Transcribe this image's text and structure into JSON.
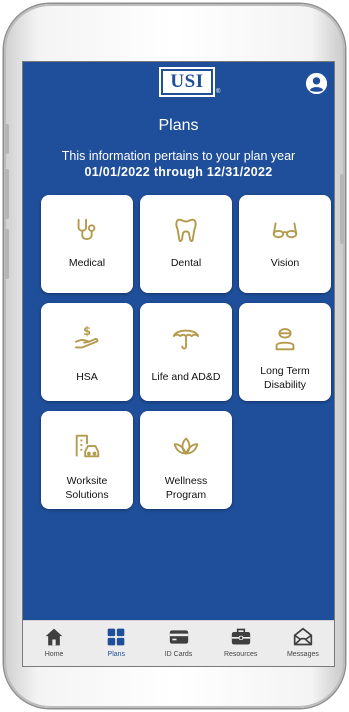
{
  "colors": {
    "primary_blue": "#1f4f9b",
    "icon_gold": "#b39a4c",
    "tab_gray": "#3f3f3f",
    "tab_active": "#1f4f9b"
  },
  "header": {
    "logo_text": "USI",
    "logo_mark": "®",
    "profile_icon": "person-circle-icon"
  },
  "page": {
    "title": "Plans",
    "info": "This information pertains to your plan year",
    "dates": "01/01/2022 through 12/31/2022"
  },
  "plans": [
    {
      "label": "Medical",
      "icon": "stethoscope-icon"
    },
    {
      "label": "Dental",
      "icon": "tooth-icon"
    },
    {
      "label": "Vision",
      "icon": "glasses-icon"
    },
    {
      "label": "HSA",
      "icon": "hand-dollar-icon"
    },
    {
      "label": "Life and AD&D",
      "icon": "umbrella-icon"
    },
    {
      "label": "Long Term Disability",
      "icon": "person-helmet-icon"
    },
    {
      "label": "Worksite Solutions",
      "icon": "building-car-icon"
    },
    {
      "label": "Wellness Program",
      "icon": "lotus-icon"
    }
  ],
  "tabs": [
    {
      "label": "Home",
      "icon": "home-icon",
      "active": false
    },
    {
      "label": "Plans",
      "icon": "grid-icon",
      "active": true
    },
    {
      "label": "ID Cards",
      "icon": "card-icon",
      "active": false
    },
    {
      "label": "Resources",
      "icon": "toolbox-icon",
      "active": false
    },
    {
      "label": "Messages",
      "icon": "envelope-icon",
      "active": false
    }
  ]
}
